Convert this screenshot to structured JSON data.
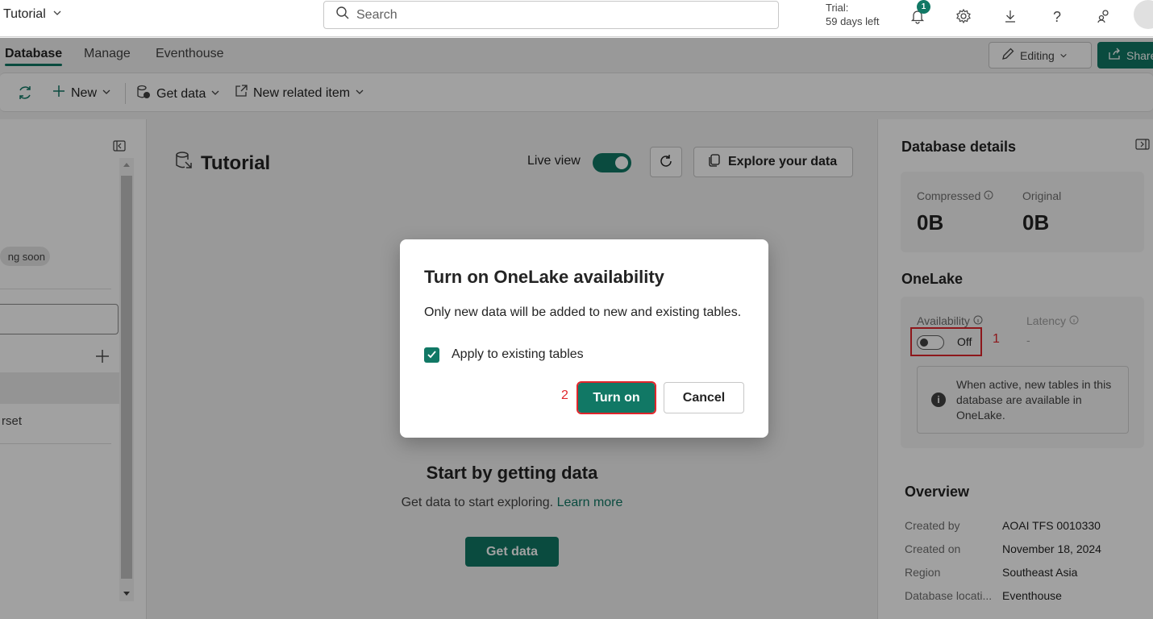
{
  "header": {
    "app_title": "Tutorial",
    "search_placeholder": "Search",
    "trial_line1": "Trial:",
    "trial_line2": "59 days left",
    "notification_count": "1"
  },
  "tabs": {
    "database": "Database",
    "manage": "Manage",
    "eventhouse": "Eventhouse",
    "editing": "Editing",
    "share": "Share"
  },
  "toolbar": {
    "new": "New",
    "get_data": "Get data",
    "new_related_item": "New related item"
  },
  "left_panel": {
    "coming_soon": "ng soon",
    "list_item": "rset"
  },
  "main": {
    "db_title": "Tutorial",
    "live_view": "Live view",
    "explore": "Explore your data",
    "start_title": "Start by getting data",
    "start_sub": "Get data to start exploring.",
    "learn_more": "Learn more",
    "get_data_button": "Get data"
  },
  "right_panel": {
    "title": "Database details",
    "compressed_label": "Compressed",
    "compressed_value": "0B",
    "original_label": "Original",
    "original_value": "0B",
    "onelake_title": "OneLake",
    "availability_label": "Availability",
    "latency_label": "Latency",
    "latency_value": "-",
    "toggle_state": "Off",
    "annotation_1": "1",
    "info_text": "When active, new tables in this database are available in OneLake.",
    "overview_title": "Overview",
    "overview": [
      {
        "key": "Created by",
        "value": "AOAI TFS 0010330"
      },
      {
        "key": "Created on",
        "value": "November 18, 2024"
      },
      {
        "key": "Region",
        "value": "Southeast Asia"
      },
      {
        "key": "Database locati...",
        "value": "Eventhouse"
      }
    ]
  },
  "dialog": {
    "title": "Turn on OneLake availability",
    "body": "Only new data will be added to new and existing tables.",
    "checkbox_label": "Apply to existing tables",
    "checkbox_checked": true,
    "annotation_2": "2",
    "turn_on": "Turn on",
    "cancel": "Cancel"
  },
  "colors": {
    "accent": "#117865",
    "annotation_red": "#e0252b"
  }
}
